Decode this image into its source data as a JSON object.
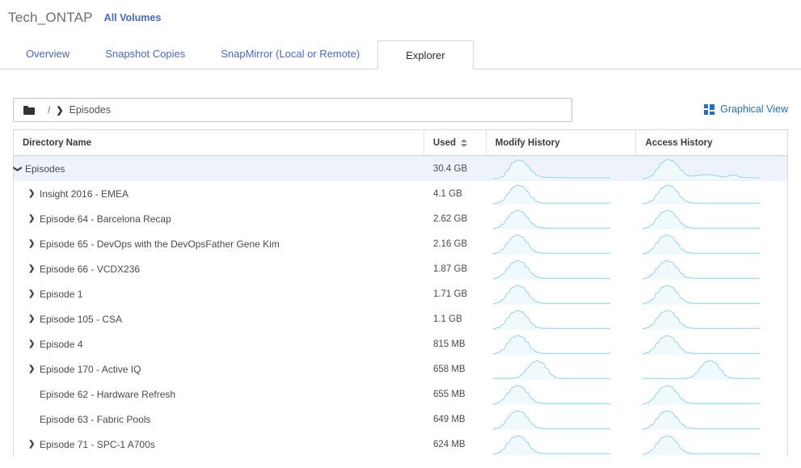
{
  "header": {
    "app_title": "Tech_ONTAP",
    "all_volumes_link": "All Volumes"
  },
  "tabs": [
    {
      "label": "Overview",
      "active": false
    },
    {
      "label": "Snapshot Copies",
      "active": false
    },
    {
      "label": "SnapMirror (Local or Remote)",
      "active": false
    },
    {
      "label": "Explorer",
      "active": true
    }
  ],
  "breadcrumb": {
    "folder_icon": "folder-icon",
    "separator": "/",
    "chevron": "❯",
    "path": "Episodes"
  },
  "graphical_view": {
    "icon": "grid-icon",
    "label": "Graphical View"
  },
  "table": {
    "columns": [
      {
        "key": "name",
        "label": "Directory Name",
        "sortable": false
      },
      {
        "key": "used",
        "label": "Used",
        "sortable": true
      },
      {
        "key": "modify",
        "label": "Modify History",
        "sortable": false
      },
      {
        "key": "access",
        "label": "Access History",
        "sortable": false
      }
    ],
    "rows": [
      {
        "name": "Episodes",
        "used": "30.4 GB",
        "level": 0,
        "expand": "down",
        "selected": true,
        "modify": [
          0,
          2,
          10,
          42,
          78,
          92,
          88,
          66,
          36,
          16,
          8,
          6,
          5,
          5,
          5,
          4,
          4,
          4,
          4,
          4,
          4,
          4,
          4,
          4,
          4
        ],
        "access": [
          0,
          4,
          16,
          48,
          80,
          95,
          90,
          70,
          40,
          18,
          12,
          14,
          18,
          20,
          19,
          15,
          10,
          8,
          16,
          18,
          8,
          5,
          4,
          4,
          4
        ]
      },
      {
        "name": "Insight 2016 - EMEA",
        "used": "4.1 GB",
        "level": 1,
        "expand": "right",
        "selected": false,
        "modify": [
          0,
          4,
          16,
          48,
          78,
          92,
          86,
          62,
          30,
          10,
          4,
          3,
          3,
          3,
          3,
          3,
          3,
          3,
          3,
          3,
          3,
          3,
          3,
          3,
          3
        ],
        "access": [
          0,
          4,
          16,
          48,
          78,
          92,
          86,
          62,
          30,
          10,
          4,
          3,
          3,
          3,
          3,
          3,
          3,
          3,
          3,
          3,
          3,
          3,
          3,
          3,
          3
        ]
      },
      {
        "name": "Episode 64 - Barcelona Recap",
        "used": "2.62 GB",
        "level": 1,
        "expand": "right",
        "selected": false,
        "modify": [
          0,
          6,
          22,
          54,
          82,
          92,
          84,
          58,
          26,
          9,
          4,
          3,
          3,
          3,
          3,
          3,
          3,
          3,
          3,
          3,
          3,
          3,
          3,
          3,
          3
        ],
        "access": [
          0,
          6,
          22,
          54,
          82,
          92,
          84,
          58,
          26,
          9,
          4,
          3,
          3,
          3,
          3,
          3,
          3,
          3,
          3,
          3,
          3,
          3,
          3,
          3,
          3
        ]
      },
      {
        "name": "Episode 65 - DevOps with the DevOpsFather Gene Kim",
        "used": "2.16 GB",
        "level": 1,
        "expand": "right",
        "selected": false,
        "modify": [
          0,
          6,
          24,
          56,
          84,
          94,
          84,
          56,
          24,
          8,
          4,
          3,
          3,
          3,
          3,
          3,
          3,
          3,
          3,
          3,
          3,
          3,
          3,
          3,
          3
        ],
        "access": [
          0,
          6,
          24,
          56,
          84,
          94,
          84,
          56,
          24,
          8,
          4,
          3,
          3,
          3,
          3,
          3,
          3,
          3,
          3,
          3,
          3,
          3,
          3,
          3,
          3
        ]
      },
      {
        "name": "Episode 66 - VCDX236",
        "used": "1.87 GB",
        "level": 1,
        "expand": "right",
        "selected": false,
        "modify": [
          0,
          6,
          22,
          52,
          80,
          90,
          82,
          56,
          26,
          9,
          4,
          3,
          3,
          3,
          3,
          3,
          3,
          3,
          3,
          3,
          3,
          3,
          3,
          3,
          3
        ],
        "access": [
          0,
          6,
          22,
          52,
          80,
          90,
          82,
          56,
          26,
          9,
          4,
          3,
          3,
          3,
          3,
          3,
          3,
          3,
          3,
          3,
          3,
          3,
          3,
          3,
          3
        ]
      },
      {
        "name": "Episode 1",
        "used": "1.71 GB",
        "level": 1,
        "expand": "right",
        "selected": false,
        "modify": [
          0,
          6,
          22,
          54,
          82,
          92,
          84,
          58,
          26,
          9,
          4,
          3,
          3,
          3,
          3,
          3,
          3,
          3,
          3,
          3,
          3,
          3,
          3,
          3,
          3
        ],
        "access": [
          0,
          6,
          22,
          54,
          82,
          92,
          84,
          58,
          26,
          9,
          4,
          3,
          3,
          3,
          3,
          3,
          3,
          3,
          3,
          3,
          3,
          3,
          3,
          3,
          3
        ]
      },
      {
        "name": "Episode 105 - CSA",
        "used": "1.1 GB",
        "level": 1,
        "expand": "right",
        "selected": false,
        "modify": [
          0,
          6,
          22,
          54,
          82,
          92,
          84,
          58,
          26,
          9,
          4,
          3,
          3,
          3,
          3,
          3,
          3,
          3,
          3,
          3,
          3,
          3,
          3,
          3,
          3
        ],
        "access": [
          0,
          6,
          22,
          54,
          82,
          92,
          84,
          58,
          26,
          9,
          4,
          3,
          3,
          3,
          3,
          3,
          3,
          3,
          3,
          3,
          3,
          3,
          3,
          3,
          3
        ]
      },
      {
        "name": "Episode 4",
        "used": "815 MB",
        "level": 1,
        "expand": "right",
        "selected": false,
        "modify": [
          0,
          6,
          22,
          54,
          82,
          92,
          84,
          58,
          26,
          9,
          4,
          3,
          3,
          3,
          3,
          3,
          3,
          3,
          3,
          3,
          3,
          3,
          3,
          3,
          3
        ],
        "access": [
          0,
          6,
          22,
          54,
          82,
          92,
          84,
          58,
          26,
          9,
          4,
          3,
          3,
          3,
          3,
          3,
          3,
          3,
          3,
          3,
          3,
          3,
          3,
          3,
          3
        ]
      },
      {
        "name": "Episode 170 - Active IQ",
        "used": "658 MB",
        "level": 1,
        "expand": "right",
        "selected": false,
        "modify": [
          3,
          3,
          3,
          3,
          4,
          8,
          24,
          54,
          80,
          90,
          82,
          54,
          22,
          7,
          3,
          3,
          3,
          3,
          3,
          3,
          3,
          3,
          3,
          3,
          3
        ],
        "access": [
          3,
          3,
          3,
          3,
          3,
          3,
          3,
          3,
          3,
          4,
          10,
          30,
          62,
          86,
          92,
          80,
          48,
          18,
          6,
          3,
          3,
          3,
          3,
          3,
          3
        ]
      },
      {
        "name": "Episode 62 - Hardware Refresh",
        "used": "655 MB",
        "level": 1,
        "expand": "none",
        "selected": false,
        "modify": [
          0,
          6,
          22,
          54,
          82,
          92,
          84,
          58,
          26,
          9,
          4,
          3,
          3,
          3,
          3,
          3,
          3,
          3,
          3,
          3,
          3,
          3,
          3,
          3,
          3
        ],
        "access": [
          0,
          6,
          22,
          54,
          82,
          92,
          84,
          58,
          26,
          9,
          4,
          3,
          3,
          3,
          3,
          3,
          3,
          3,
          3,
          3,
          3,
          3,
          3,
          3,
          3
        ]
      },
      {
        "name": "Episode 63 - Fabric Pools",
        "used": "649 MB",
        "level": 1,
        "expand": "none",
        "selected": false,
        "modify": [
          0,
          6,
          22,
          54,
          82,
          92,
          84,
          58,
          26,
          9,
          4,
          3,
          3,
          3,
          3,
          3,
          3,
          3,
          3,
          3,
          3,
          3,
          3,
          3,
          3
        ],
        "access": [
          0,
          6,
          22,
          54,
          82,
          92,
          84,
          58,
          26,
          9,
          4,
          3,
          3,
          3,
          3,
          3,
          3,
          3,
          3,
          3,
          3,
          3,
          3,
          3,
          3
        ]
      },
      {
        "name": "Episode 71 - SPC-1 A700s",
        "used": "624 MB",
        "level": 1,
        "expand": "right",
        "selected": false,
        "modify": [
          0,
          6,
          22,
          54,
          82,
          92,
          84,
          58,
          26,
          9,
          4,
          3,
          3,
          3,
          3,
          3,
          3,
          3,
          3,
          3,
          3,
          3,
          3,
          3,
          3
        ],
        "access": [
          0,
          6,
          22,
          54,
          82,
          92,
          84,
          58,
          26,
          9,
          4,
          3,
          3,
          3,
          3,
          3,
          3,
          3,
          3,
          3,
          3,
          3,
          3,
          3,
          3
        ]
      }
    ]
  },
  "colors": {
    "link": "#4668d4",
    "accent": "#1f6fd0",
    "spark_stroke": "#8fd4e8",
    "spark_fill": "#f0fafd",
    "row_selected": "#eef2fb"
  }
}
